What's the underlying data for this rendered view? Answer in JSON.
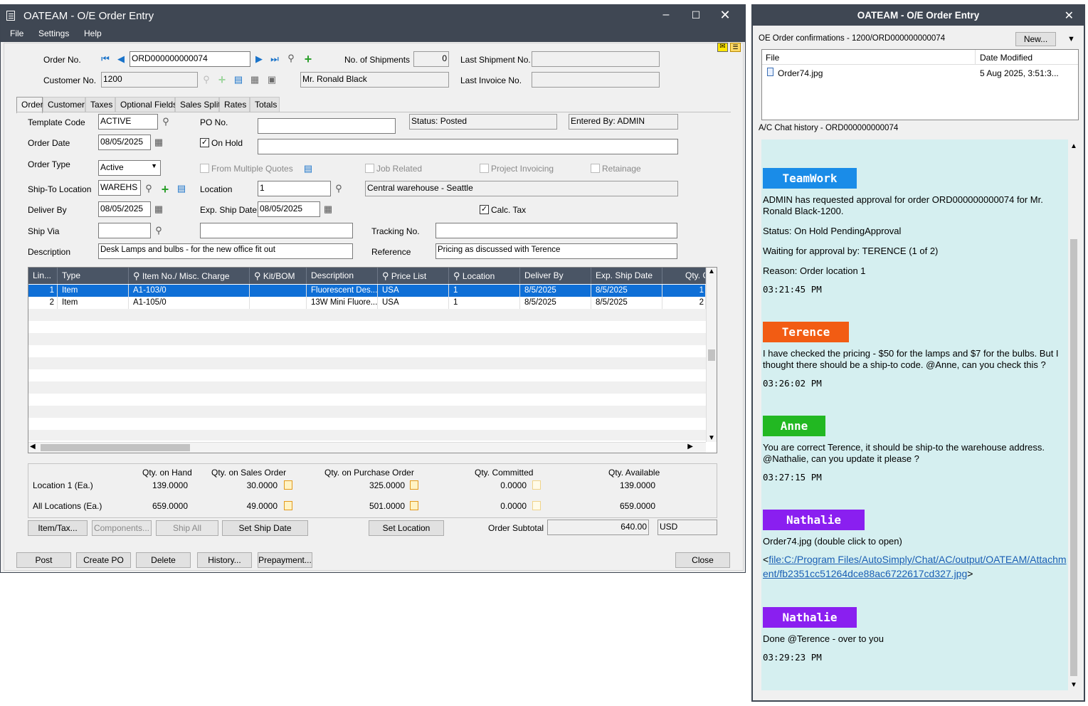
{
  "main": {
    "title": "OATEAM - O/E Order Entry",
    "menu": [
      "File",
      "Settings",
      "Help"
    ],
    "header": {
      "order_no_label": "Order No.",
      "order_no": "ORD000000000074",
      "customer_no_label": "Customer No.",
      "customer_no": "1200",
      "customer_name": "Mr. Ronald Black",
      "shipments_label": "No. of Shipments",
      "shipments": "0",
      "last_shipment_label": "Last Shipment No.",
      "last_shipment": "",
      "last_invoice_label": "Last Invoice No.",
      "last_invoice": ""
    },
    "tabs": [
      "Order",
      "Customer",
      "Taxes",
      "Optional Fields",
      "Sales Split",
      "Rates",
      "Totals"
    ],
    "order": {
      "template_label": "Template Code",
      "template": "ACTIVE",
      "po_label": "PO No.",
      "po": "",
      "status": "Status: Posted",
      "entered_by": "Entered By: ADMIN",
      "order_date_label": "Order Date",
      "order_date": "08/05/2025",
      "on_hold_label": "On Hold",
      "on_hold_checked": "✓",
      "on_hold_reason": "",
      "order_type_label": "Order Type",
      "order_type": "Active",
      "from_quotes_label": "From Multiple Quotes",
      "job_related_label": "Job Related",
      "project_invoicing_label": "Project Invoicing",
      "retainage_label": "Retainage",
      "ship_to_label": "Ship-To Location",
      "ship_to": "WAREHS",
      "location_label": "Location",
      "location": "1",
      "location_desc": "Central warehouse - Seattle",
      "deliver_by_label": "Deliver By",
      "deliver_by": "08/05/2025",
      "exp_ship_label": "Exp. Ship Date",
      "exp_ship": "08/05/2025",
      "calc_tax_label": "Calc. Tax",
      "calc_tax_checked": "✓",
      "ship_via_label": "Ship Via",
      "ship_via": "",
      "ship_via_desc": "",
      "tracking_label": "Tracking No.",
      "tracking": "",
      "description_label": "Description",
      "description": "Desk Lamps and bulbs - for the new office fit out",
      "reference_label": "Reference",
      "reference": "Pricing as discussed with Terence"
    },
    "grid": {
      "columns": [
        "Lin...",
        "Type",
        "Item No./ Misc. Charge",
        "Kit/BOM",
        "Description",
        "Price List",
        "Location",
        "Deliver By",
        "Exp. Ship Date",
        "Qty. O"
      ],
      "rows": [
        [
          "1",
          "Item",
          "A1-103/0",
          "",
          "Fluorescent Des...",
          "USA",
          "1",
          "8/5/2025",
          "8/5/2025",
          "1"
        ],
        [
          "2",
          "Item",
          "A1-105/0",
          "",
          "13W Mini Fluore...",
          "USA",
          "1",
          "8/5/2025",
          "8/5/2025",
          "2"
        ]
      ]
    },
    "stats": {
      "headers": [
        "Qty. on Hand",
        "Qty. on Sales Order",
        "Qty. on Purchase Order",
        "Qty. Committed",
        "Qty. Available"
      ],
      "rows": [
        {
          "label": "Location  1 (Ea.)",
          "values": [
            "139.0000",
            "30.0000",
            "325.0000",
            "0.0000",
            "139.0000"
          ]
        },
        {
          "label": "All Locations (Ea.)",
          "values": [
            "659.0000",
            "49.0000",
            "501.0000",
            "0.0000",
            "659.0000"
          ]
        }
      ]
    },
    "buttons": {
      "item_tax": "Item/Tax...",
      "components": "Components...",
      "ship_all": "Ship All",
      "set_ship_date": "Set Ship Date",
      "set_location": "Set Location",
      "subtotal_label": "Order Subtotal",
      "subtotal": "640.00",
      "currency": "USD",
      "post": "Post",
      "create_po": "Create PO",
      "delete": "Delete",
      "history": "History...",
      "prepayment": "Prepayment...",
      "close": "Close"
    }
  },
  "chat": {
    "title": "OATEAM - O/E Order Entry",
    "confirm_label": "OE Order confirmations - 1200/ORD000000000074",
    "new_button": "New...",
    "pin_icon": "pin-icon",
    "file_headers": [
      "File",
      "Date Modified"
    ],
    "files": [
      {
        "name": "Order74.jpg",
        "date": "5 Aug 2025, 3:51:3..."
      }
    ],
    "history_label": "A/C Chat history - ORD000000000074",
    "messages": [
      {
        "author": "TeamWork",
        "color": "#1a8ce8",
        "lines": [
          "ADMIN has requested approval for order ORD000000000074 for Mr. Ronald Black-1200.",
          "Status: On Hold PendingApproval",
          "Waiting for approval by: TERENCE (1 of 2)",
          "Reason: Order location 1"
        ],
        "time": "03:21:45 PM"
      },
      {
        "author": "Terence",
        "color": "#f25c13",
        "lines": [
          "I have checked the pricing - $50 for the lamps and $7 for the bulbs.  But I thought there should be a ship-to code.  @Anne, can you check this ?"
        ],
        "time": "03:26:02 PM"
      },
      {
        "author": "Anne",
        "color": "#22b822",
        "lines": [
          "You are correct Terence, it should be ship-to the warehouse address. @Nathalie, can you update it please ?"
        ],
        "time": "03:27:15 PM"
      },
      {
        "author": "Nathalie",
        "color": "#8a1ff0",
        "lines": [
          "Order74.jpg (double click to open)"
        ],
        "link_open": "<",
        "link": "file:C:/Program Files/AutoSimply/Chat/AC/output/OATEAM/Attachment/fb2351cc51264dce88ac6722617cd327.jpg",
        "link_close": ">"
      },
      {
        "author": "Nathalie",
        "color": "#8a1ff0",
        "lines": [
          "Done @Terence - over to you"
        ],
        "time": "03:29:23 PM"
      }
    ]
  }
}
